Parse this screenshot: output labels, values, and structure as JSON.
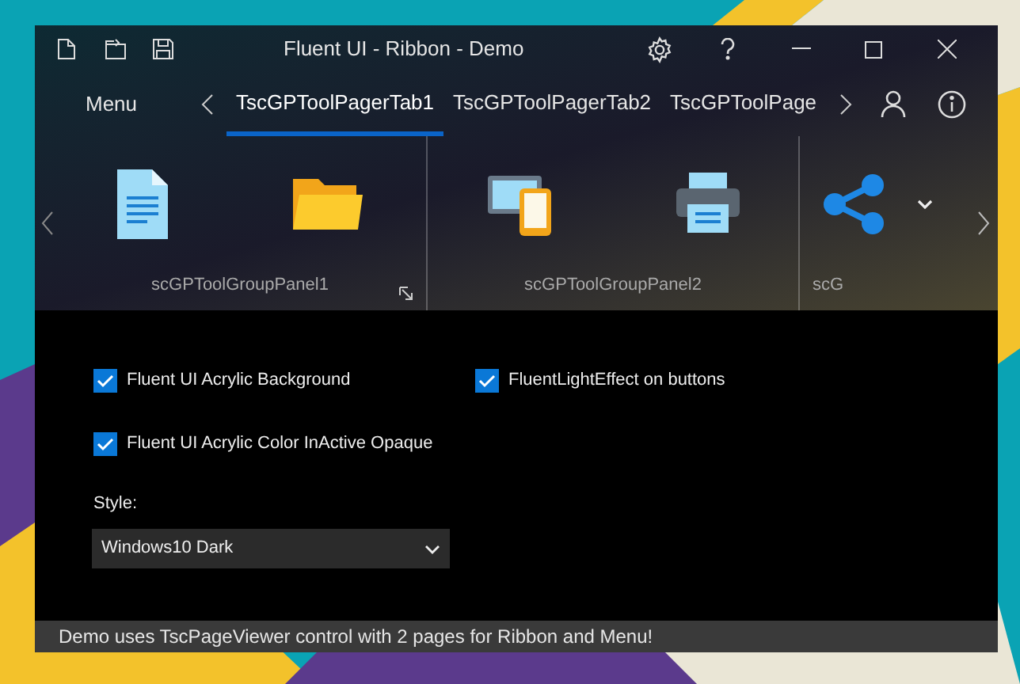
{
  "window": {
    "title": "Fluent UI - Ribbon - Demo"
  },
  "menu_button": "Menu",
  "tabs": [
    {
      "label": "TscGPToolPagerTab1",
      "selected": true
    },
    {
      "label": "TscGPToolPagerTab2",
      "selected": false
    },
    {
      "label": "TscGPToolPage",
      "selected": false
    }
  ],
  "ribbon_groups": [
    {
      "label": "scGPToolGroupPanel1",
      "tools": [
        {
          "kind": "document"
        },
        {
          "kind": "folder"
        }
      ],
      "launcher": true
    },
    {
      "label": "scGPToolGroupPanel2",
      "tools": [
        {
          "kind": "devices"
        },
        {
          "kind": "printer"
        }
      ],
      "launcher": false
    },
    {
      "label": "scG",
      "tools": [
        {
          "kind": "share"
        }
      ],
      "launcher": false
    }
  ],
  "options": [
    {
      "label": "Fluent UI Acrylic Background",
      "checked": true
    },
    {
      "label": "FluentLightEffect on buttons",
      "checked": true
    },
    {
      "label": "Fluent UI Acrylic Color InActive Opaque",
      "checked": true
    }
  ],
  "style": {
    "label": "Style:",
    "value": "Windows10 Dark"
  },
  "status_bar": "Demo uses TscPageViewer control with 2 pages for Ribbon and Menu!"
}
